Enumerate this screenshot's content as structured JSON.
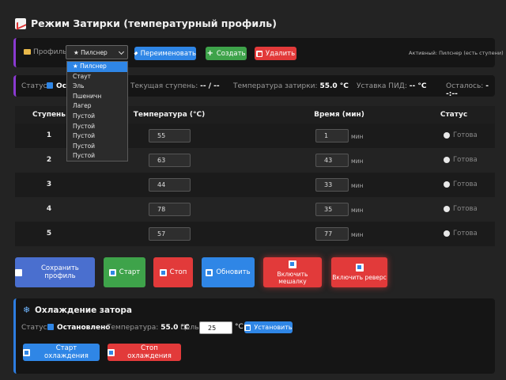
{
  "page": {
    "title": "Режим Затирки (температурный профиль)"
  },
  "profile_bar": {
    "label": "Профиль:",
    "selected": "★ Пилснер",
    "rename": "Переименовать",
    "create": "Создать",
    "delete": "Удалить",
    "active_note": "Активный: Пилснер (есть ступени)"
  },
  "dropdown": {
    "options": [
      "★ Пилснер",
      "Стаут",
      "Эль",
      "Пшеничн",
      "Лагер",
      "Пустой",
      "Пустой",
      "Пустой",
      "Пустой",
      "Пустой"
    ]
  },
  "status_bar": {
    "status_label": "Статус:",
    "status_value": "Остановлено",
    "step_label": "Текущая ступень:",
    "step_value": "-- / --",
    "temp_label": "Температура затирки:",
    "temp_value": "55.0 °C",
    "pid_label": "Уставка ПИД:",
    "pid_value": "-- °C",
    "left_label": "Осталось:",
    "left_value": "--:--"
  },
  "table": {
    "headers": [
      "Ступень",
      "Температура (°C)",
      "Время (мин)",
      "Статус"
    ],
    "unit": "мин",
    "status_text": "Готова",
    "rows": [
      {
        "n": "1",
        "temp": "55",
        "time": "1"
      },
      {
        "n": "2",
        "temp": "63",
        "time": "43"
      },
      {
        "n": "3",
        "temp": "44",
        "time": "33"
      },
      {
        "n": "4",
        "temp": "78",
        "time": "35"
      },
      {
        "n": "5",
        "temp": "57",
        "time": "77"
      }
    ]
  },
  "actions": {
    "save": "Сохранить профиль",
    "start": "Старт",
    "stop": "Стоп",
    "refresh": "Обновить",
    "mixer_on": "Включить мешалку",
    "reverse_on": "Включить реверс"
  },
  "cooling": {
    "title": "Охлаждение затора",
    "status_label": "Статус:",
    "status_value": "Остановлено",
    "temp_label": "Температура:",
    "temp_value": "55.0 °C",
    "target_label": "Цель",
    "target_value": "25",
    "target_unit": "°C",
    "set_button": "Установить",
    "start": "Старт охлаждения",
    "stop": "Стоп охлаждения"
  }
}
